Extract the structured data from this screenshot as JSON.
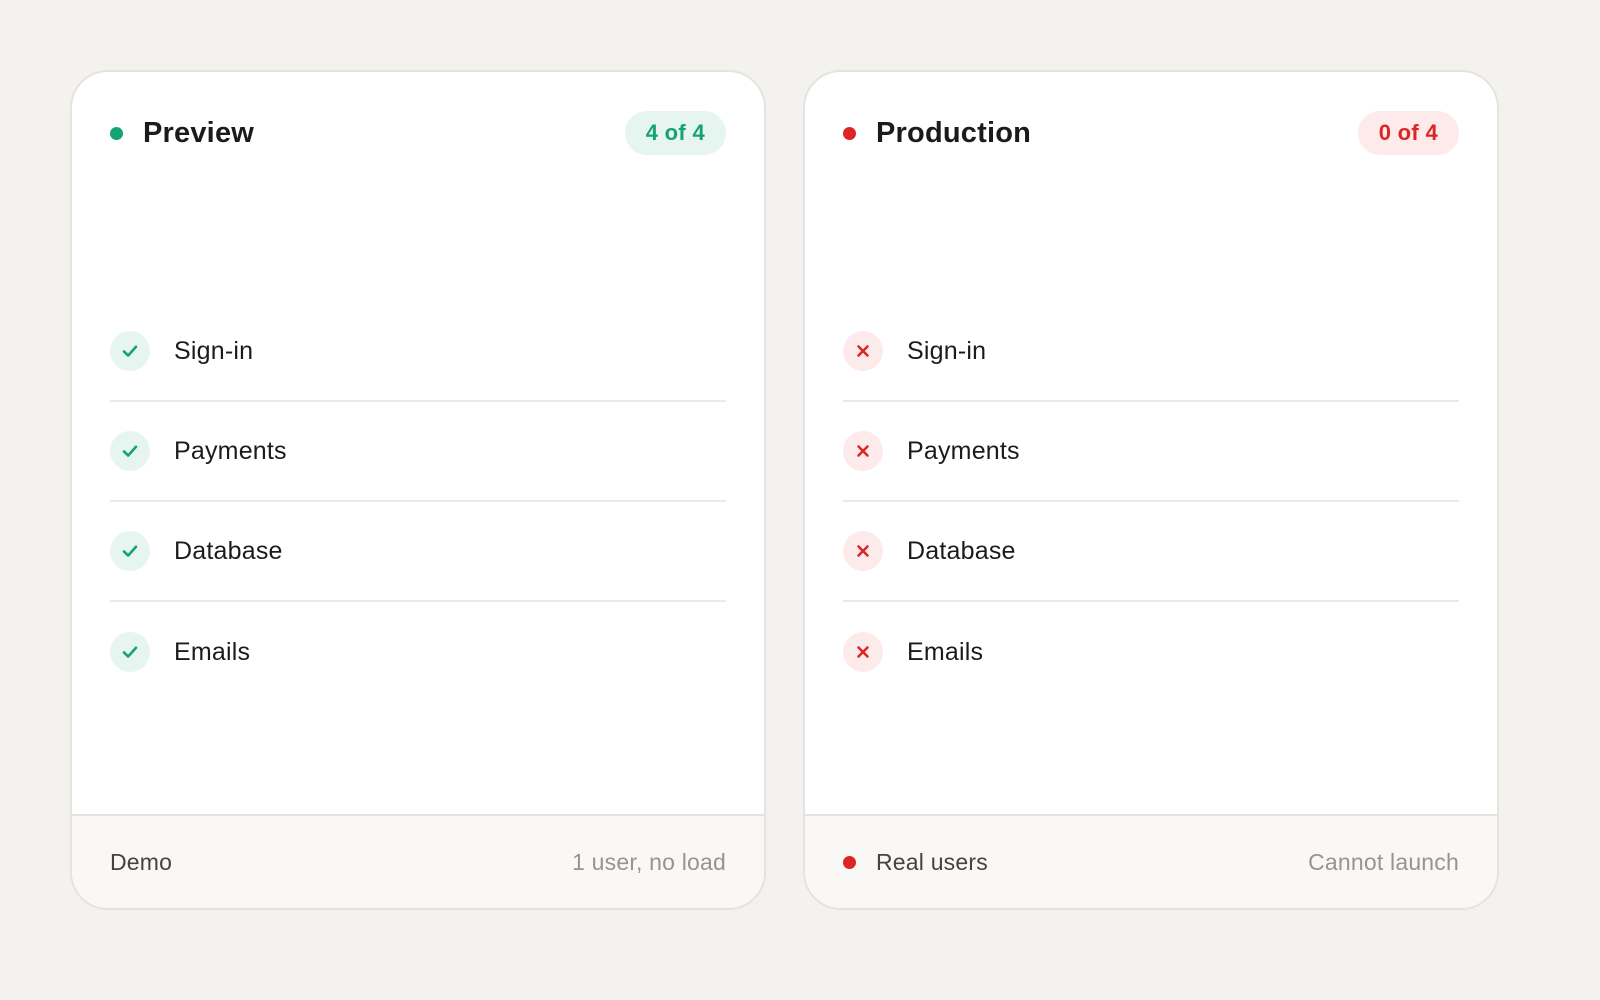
{
  "colors": {
    "success": "#16a374",
    "success_bg": "#e6f5ef",
    "danger": "#dc2626",
    "danger_bg": "#fdeaea"
  },
  "preview": {
    "title": "Preview",
    "badge": "4 of 4",
    "checks": [
      {
        "label": "Sign-in",
        "status": "pass",
        "icon": "check-icon"
      },
      {
        "label": "Payments",
        "status": "pass",
        "icon": "check-icon"
      },
      {
        "label": "Database",
        "status": "pass",
        "icon": "check-icon"
      },
      {
        "label": "Emails",
        "status": "pass",
        "icon": "check-icon"
      }
    ],
    "footer": {
      "label": "Demo",
      "note": "1 user, no load"
    }
  },
  "production": {
    "title": "Production",
    "badge": "0 of 4",
    "checks": [
      {
        "label": "Sign-in",
        "status": "fail",
        "icon": "x-icon"
      },
      {
        "label": "Payments",
        "status": "fail",
        "icon": "x-icon"
      },
      {
        "label": "Database",
        "status": "fail",
        "icon": "x-icon"
      },
      {
        "label": "Emails",
        "status": "fail",
        "icon": "x-icon"
      }
    ],
    "footer": {
      "label": "Real users",
      "note": "Cannot launch"
    }
  }
}
